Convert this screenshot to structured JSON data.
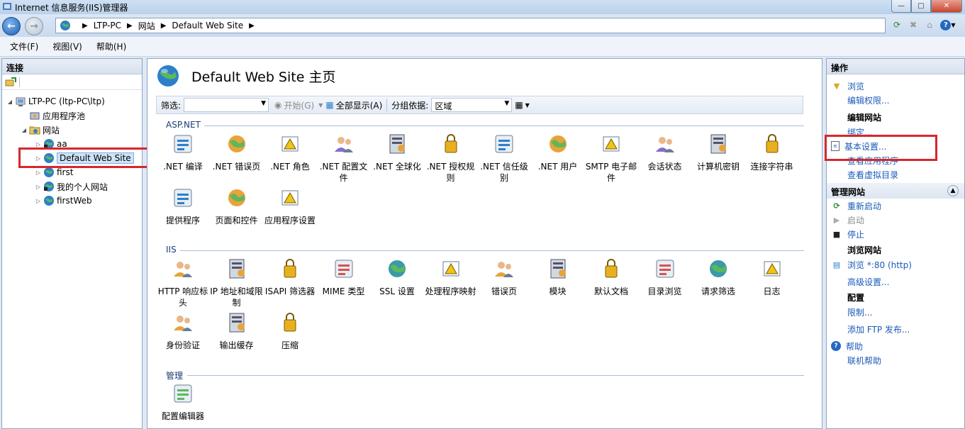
{
  "window": {
    "title": "Internet 信息服务(IIS)管理器"
  },
  "address": {
    "crumbs": [
      "LTP-PC",
      "网站",
      "Default Web Site"
    ]
  },
  "menu": [
    "文件(F)",
    "视图(V)",
    "帮助(H)"
  ],
  "left": {
    "header": "连接",
    "tree": [
      {
        "label": "LTP-PC (ltp-PC\\ltp)",
        "icon": "server-icon"
      },
      {
        "label": "应用程序池",
        "icon": "app-pool-icon"
      },
      {
        "label": "网站",
        "icon": "folder-icon"
      },
      {
        "label": "aa",
        "icon": "globe-icon"
      },
      {
        "label": "Default Web Site",
        "icon": "globe-icon",
        "selected": true
      },
      {
        "label": "first",
        "icon": "globe-icon"
      },
      {
        "label": "我的个人网站",
        "icon": "globe-icon"
      },
      {
        "label": "firstWeb",
        "icon": "globe-icon"
      }
    ]
  },
  "center": {
    "title": "Default Web Site 主页",
    "filter": {
      "label": "筛选:",
      "start": "开始(G)",
      "show_all": "全部显示(A)",
      "group_label": "分组依据:",
      "group_value": "区域"
    },
    "sections": [
      {
        "title": "ASP.NET",
        "items": [
          ".NET 编译",
          ".NET 错误页",
          ".NET 角色",
          ".NET 配置文件",
          ".NET 全球化",
          ".NET 授权规则",
          ".NET 信任级别",
          ".NET 用户",
          "SMTP 电子邮件",
          "会话状态",
          "计算机密钥",
          "连接字符串",
          "提供程序",
          "页面和控件",
          "应用程序设置"
        ]
      },
      {
        "title": "IIS",
        "items": [
          "HTTP 响应标头",
          "IP 地址和域限制",
          "ISAPI 筛选器",
          "MIME 类型",
          "SSL 设置",
          "处理程序映射",
          "错误页",
          "模块",
          "默认文档",
          "目录浏览",
          "请求筛选",
          "日志",
          "身份验证",
          "输出缓存",
          "压缩"
        ]
      },
      {
        "title": "管理",
        "items": [
          "配置编辑器"
        ]
      }
    ]
  },
  "right": {
    "header": "操作",
    "group1": {
      "items": [
        "浏览",
        "编辑权限..."
      ]
    },
    "edit_site": {
      "title": "编辑网站",
      "items": [
        "绑定...",
        "基本设置...",
        "查看应用程序",
        "查看虚拟目录"
      ]
    },
    "manage": {
      "title": "管理网站",
      "items": [
        "重新启动",
        "启动",
        "停止"
      ]
    },
    "browse": {
      "title": "浏览网站",
      "items": [
        "浏览 *:80 (http)"
      ]
    },
    "advanced": "高级设置...",
    "config": {
      "title": "配置",
      "items": [
        "限制..."
      ]
    },
    "ftp": "添加 FTP 发布...",
    "help": {
      "items": [
        "帮助",
        "联机帮助"
      ]
    }
  },
  "colors": {
    "highlight": "#d8262c",
    "link": "#1a5ab8",
    "section": "#1a3b73"
  }
}
